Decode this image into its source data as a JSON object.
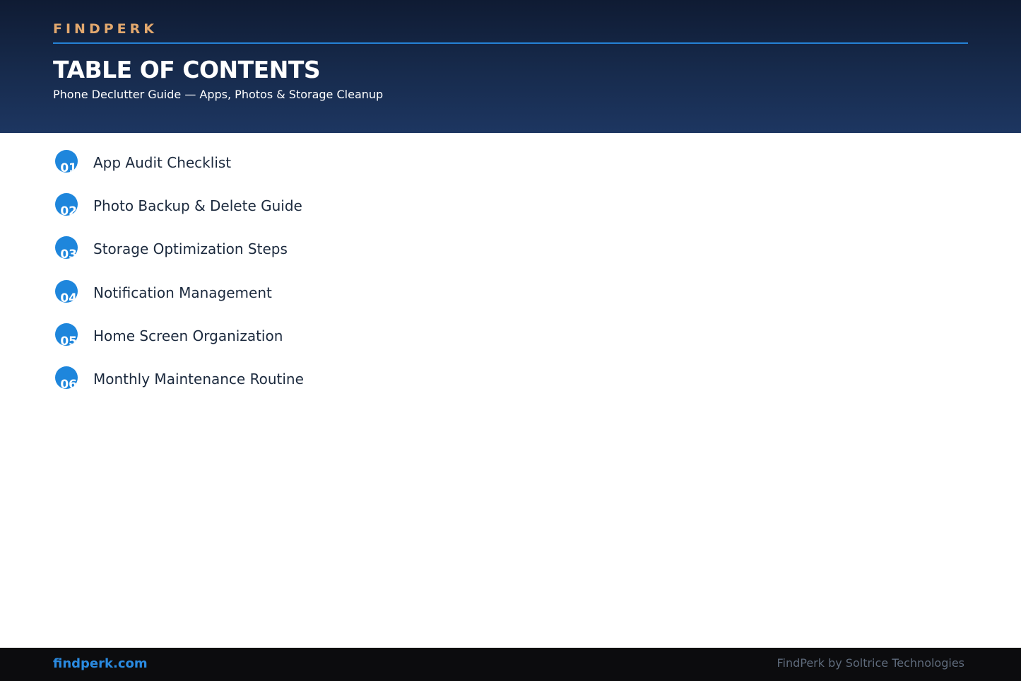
{
  "header": {
    "brand": "FINDPERK",
    "title": "TABLE OF CONTENTS",
    "subtitle": "Phone Declutter Guide — Apps, Photos & Storage Cleanup"
  },
  "toc": {
    "items": [
      {
        "number": "01",
        "label": "App Audit Checklist"
      },
      {
        "number": "02",
        "label": "Photo Backup & Delete Guide"
      },
      {
        "number": "03",
        "label": "Storage Optimization Steps"
      },
      {
        "number": "04",
        "label": "Notification Management"
      },
      {
        "number": "05",
        "label": "Home Screen Organization"
      },
      {
        "number": "06",
        "label": "Monthly Maintenance Routine"
      }
    ]
  },
  "footer": {
    "link": "findperk.com",
    "credit": "FindPerk by Soltrice Technologies"
  },
  "colors": {
    "header_background": "#172b4d",
    "brand_accent": "#e2a86e",
    "divider": "#2582d6",
    "number_badge": "#1e86dc",
    "footer_background": "#0c0c0e",
    "footer_link": "#2a8ae0"
  }
}
